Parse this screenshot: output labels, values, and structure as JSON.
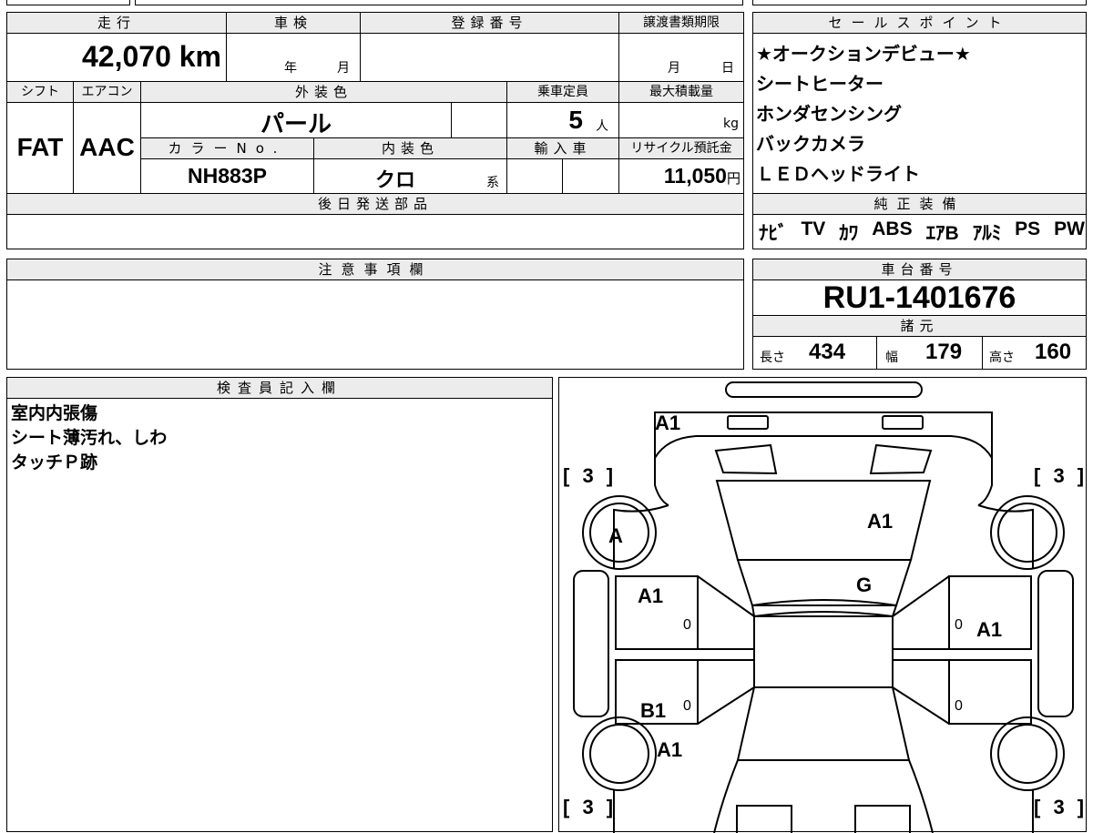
{
  "header": {
    "mileage_label": "走行",
    "shaken_label": "車検",
    "reg_number_label": "登録番号",
    "transfer_deadline_label": "譲渡書類期限",
    "sales_points_label": "セールスポイント"
  },
  "mileage": {
    "value": "42,070",
    "unit": "km"
  },
  "shaken": {
    "year_label": "年",
    "month_label": "月"
  },
  "transfer": {
    "month_label": "月",
    "day_label": "日"
  },
  "specs": {
    "shift_label": "シフト",
    "aircon_label": "エアコン",
    "exterior_color_label": "外装色",
    "capacity_label": "乗車定員",
    "max_load_label": "最大積載量",
    "shift_value": "FAT",
    "aircon_value": "AAC",
    "exterior_color_value": "パール",
    "capacity_value": "5",
    "capacity_unit": "人",
    "max_load_unit": "kg",
    "color_no_label": "カラーNo.",
    "interior_color_label": "内装色",
    "import_label": "輸入車",
    "recycle_label": "リサイクル預託金",
    "color_no_value": "NH883P",
    "interior_color_value": "クロ",
    "interior_color_suffix": "系",
    "recycle_value": "11,050",
    "recycle_unit": "円"
  },
  "sales_points": [
    "★オークションデビュー★",
    "シートヒーター",
    "ホンダセンシング",
    "バックカメラ",
    "ＬＥＤヘッドライト"
  ],
  "later_parts_label": "後日発送部品",
  "genuine_equipment": {
    "label": "純正装備",
    "items": [
      "ﾅﾋﾞ",
      "TV",
      "ｶﾜ",
      "ABS",
      "ｴｱB",
      "ｱﾙﾐ",
      "PS",
      "PW"
    ]
  },
  "notes_label": "注意事項欄",
  "chassis": {
    "label": "車台番号",
    "value": "RU1-1401676"
  },
  "dimensions": {
    "label": "諸元",
    "length_label": "長さ",
    "length_value": "434",
    "width_label": "幅",
    "width_value": "179",
    "height_label": "高さ",
    "height_value": "160"
  },
  "inspector": {
    "label": "検査員記入欄",
    "lines": [
      "室内内張傷",
      "シート薄汚れ、しわ",
      "タッチＰ跡"
    ]
  },
  "diagram": {
    "tire_top_left": "[ 3 ]",
    "tire_top_right": "[ 3 ]",
    "tire_bottom_left": "[ 3 ]",
    "tire_bottom_right": "[ 3 ]",
    "mark_rear_bumper": "A1",
    "mark_hood": "A1",
    "mark_windshield": "G",
    "mark_left_front_wheel": "A",
    "mark_left_fender": "A1",
    "mark_right_fender": "A1",
    "mark_left_rear_door": "B1",
    "mark_left_rear_quarter": "A1",
    "zero_left_upper": "0",
    "zero_left_lower": "0",
    "zero_right_upper": "0",
    "zero_right_lower": "0"
  }
}
